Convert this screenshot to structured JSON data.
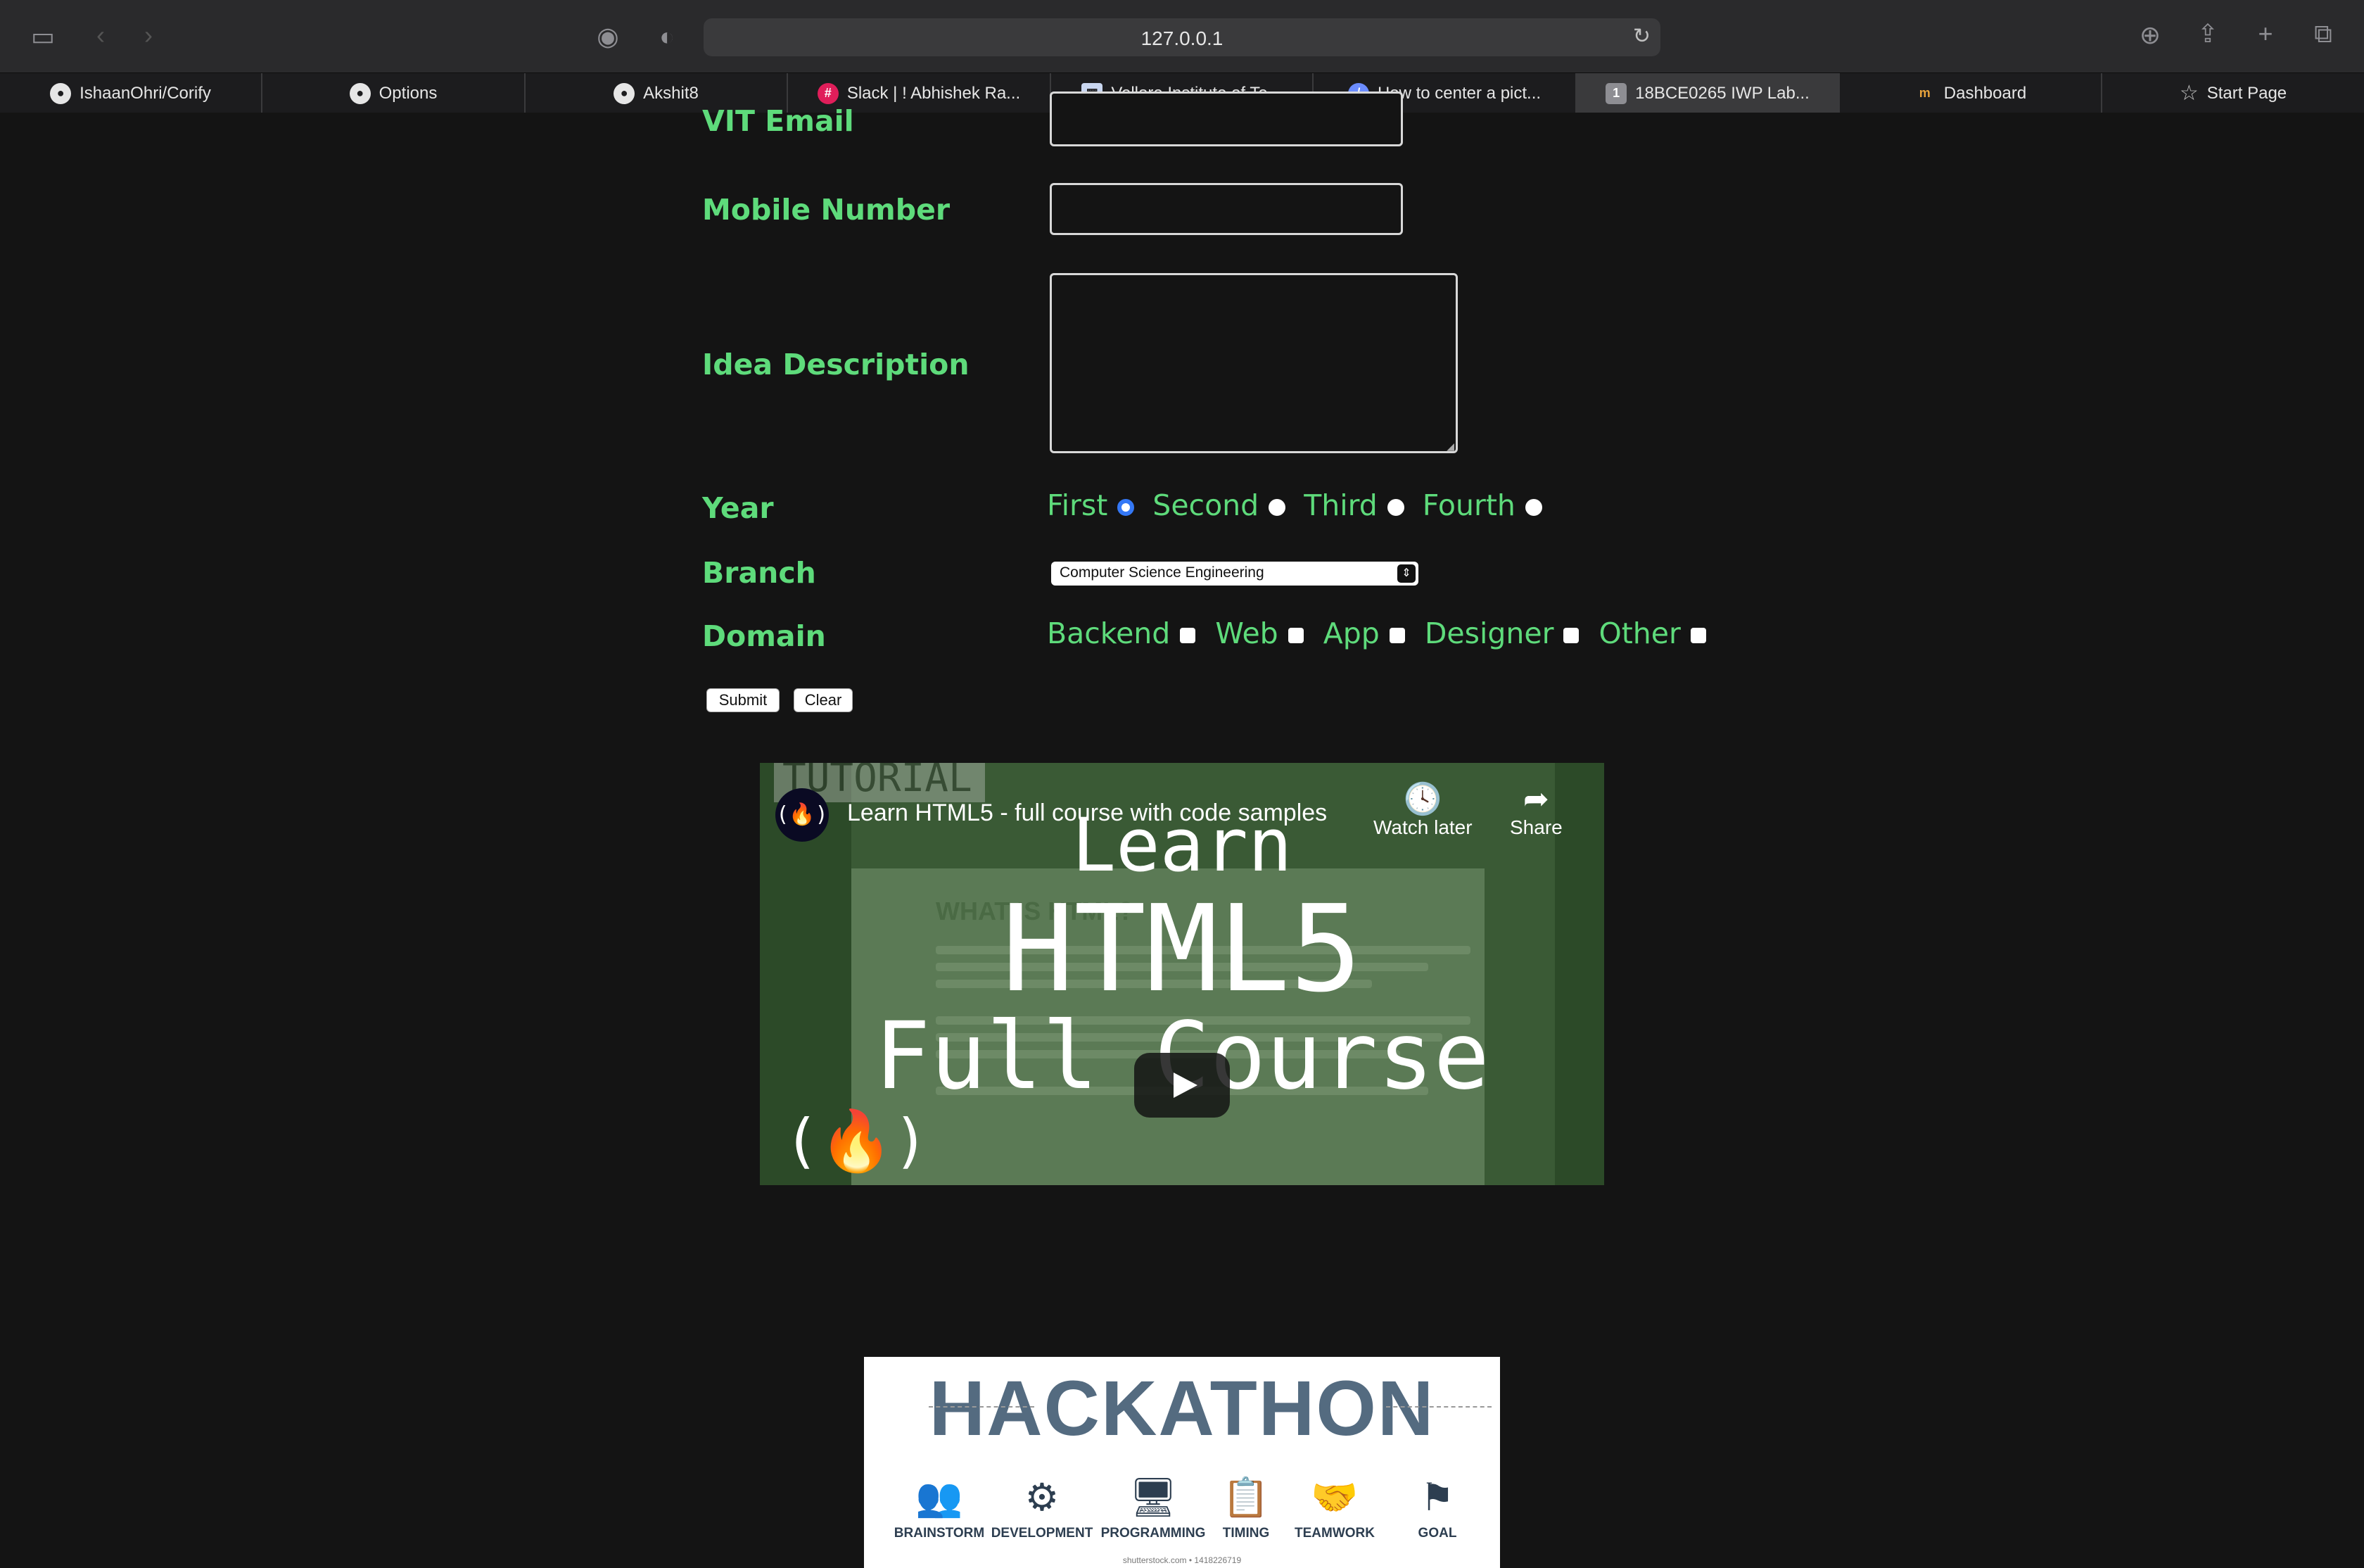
{
  "browser": {
    "url": "127.0.0.1",
    "tabs": [
      {
        "label": "IshaanOhri/Corify",
        "icon": "github-icon"
      },
      {
        "label": "Options",
        "icon": "github-icon"
      },
      {
        "label": "Akshit8",
        "icon": "github-icon"
      },
      {
        "label": "Slack | ! Abhishek Ra...",
        "icon": "slack-icon"
      },
      {
        "label": "Vellore Institute of Te...",
        "icon": "vit-icon"
      },
      {
        "label": "How to center a pict...",
        "icon": "page-icon"
      },
      {
        "label": "18BCE0265 IWP Lab...",
        "icon": "page-icon",
        "active": true
      },
      {
        "label": "Dashboard",
        "icon": "dashboard-icon"
      },
      {
        "label": "Start Page",
        "icon": "star-icon"
      }
    ]
  },
  "form": {
    "vit_email_label": "VIT Email",
    "mobile_label": "Mobile Number",
    "idea_label": "Idea Description",
    "year_label": "Year",
    "year_options": [
      "First",
      "Second",
      "Third",
      "Fourth"
    ],
    "year_selected": "First",
    "branch_label": "Branch",
    "branch_value": "Computer Science Engineering",
    "domain_label": "Domain",
    "domain_options": [
      "Backend",
      "Web",
      "App",
      "Designer",
      "Other"
    ],
    "submit_label": "Submit",
    "clear_label": "Clear"
  },
  "video": {
    "title": "Learn HTML5 - full course with code samples",
    "watch_later": "Watch later",
    "share": "Share",
    "thumb_line1": "Learn",
    "thumb_line2": "HTML5",
    "thumb_line3": "Full Course",
    "thumb_badge": "TUTORIAL",
    "doc_heading": "WHAT IS HTML?",
    "channel_mark": "(🔥)"
  },
  "hackathon": {
    "title": "HACKATHON",
    "items": [
      "BRAINSTORM",
      "DEVELOPMENT",
      "PROGRAMMING",
      "TIMING",
      "TEAMWORK",
      "GOAL"
    ],
    "credit": "shutterstock.com • 1418226719"
  }
}
